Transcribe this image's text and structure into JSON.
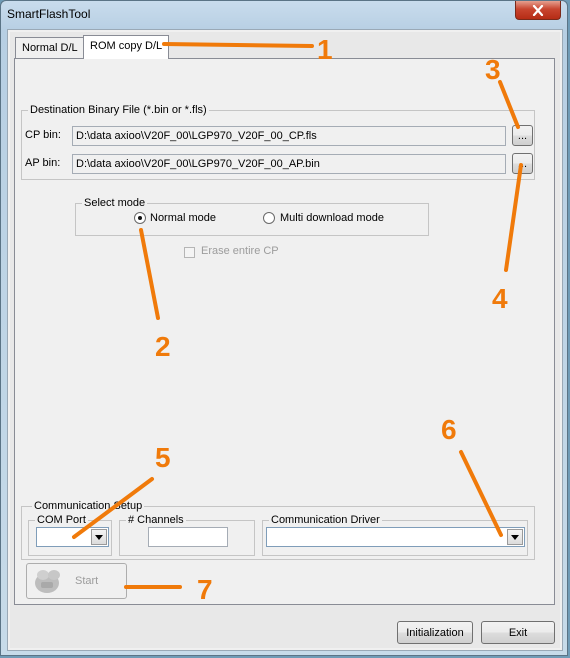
{
  "window": {
    "title": "SmartFlashTool"
  },
  "tabs": [
    {
      "label": "Normal D/L",
      "active": false
    },
    {
      "label": "ROM copy D/L",
      "active": true
    }
  ],
  "destination": {
    "legend": "Destination Binary File (*.bin or *.fls)",
    "cp_label": "CP bin:",
    "cp_value": "D:\\data axioo\\V20F_00\\LGP970_V20F_00_CP.fls",
    "ap_label": "AP bin:",
    "ap_value": "D:\\data axioo\\V20F_00\\LGP970_V20F_00_AP.bin",
    "browse_label": "..."
  },
  "select_mode": {
    "legend": "Select mode",
    "options": [
      {
        "label": "Normal mode",
        "selected": true
      },
      {
        "label": "Multi download mode",
        "selected": false
      }
    ],
    "erase_label": "Erase entire CP",
    "erase_checked": false,
    "erase_enabled": false
  },
  "communication": {
    "legend": "Communication Setup",
    "com_port_label": "COM Port",
    "com_port_value": "",
    "channels_label": "# Channels",
    "channels_value": "",
    "driver_label": "Communication Driver",
    "driver_value": ""
  },
  "buttons": {
    "start": "Start",
    "start_enabled": false,
    "initialization": "Initialization",
    "exit": "Exit"
  },
  "annotations": {
    "color": "#f07a0a",
    "numbers": [
      "1",
      "2",
      "3",
      "4",
      "5",
      "6",
      "7"
    ]
  }
}
